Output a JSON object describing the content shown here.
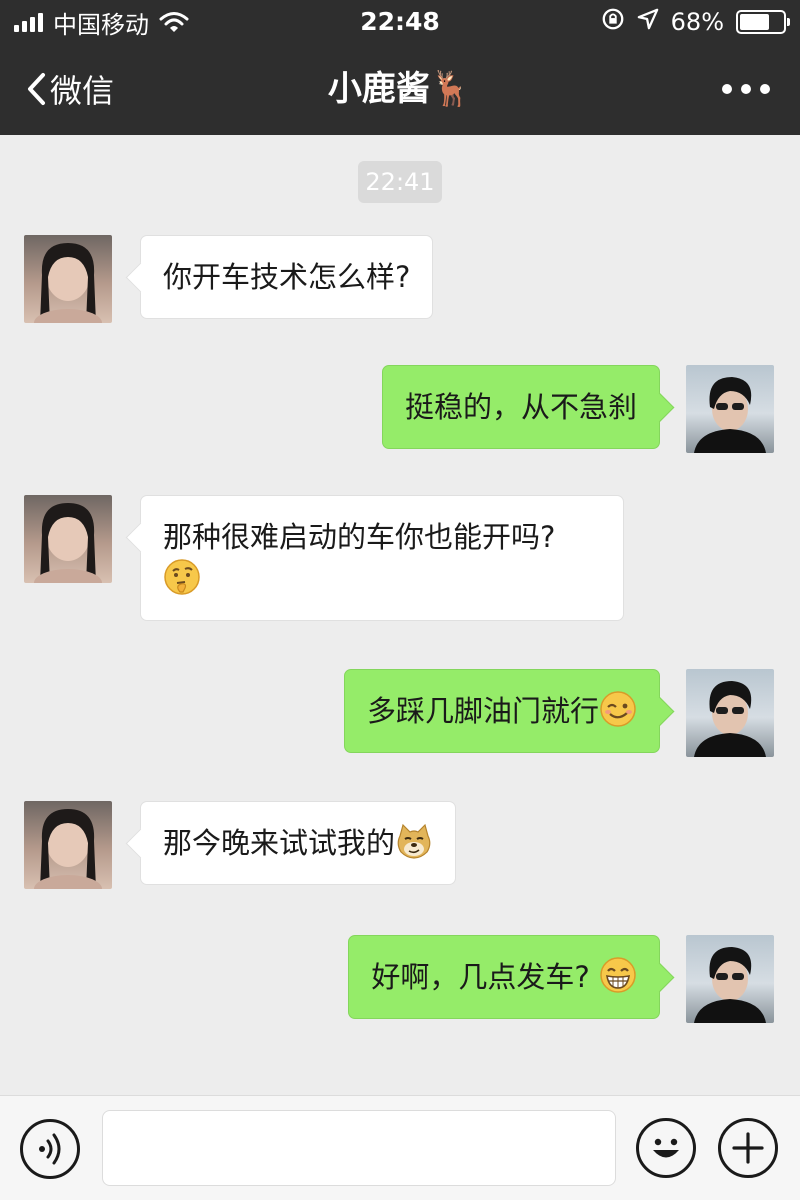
{
  "status_bar": {
    "carrier": "中国移动",
    "time": "22:48",
    "battery_percent": "68%",
    "battery_level": 0.68,
    "icons": [
      "signal-icon",
      "wifi-icon",
      "rotation-lock-icon",
      "location-icon",
      "battery-icon"
    ]
  },
  "nav": {
    "back_label": "微信",
    "title": "小鹿酱🦌",
    "icons": [
      "chevron-left-icon",
      "more-icon"
    ]
  },
  "chat": {
    "timestamp": "22:41",
    "messages": [
      {
        "side": "in",
        "text": "你开车技术怎么样?",
        "emoji": ""
      },
      {
        "side": "out",
        "text": "挺稳的，从不急刹",
        "emoji": ""
      },
      {
        "side": "in",
        "text": "那种很难启动的车你也能开吗?",
        "emoji": "thinking-emoji"
      },
      {
        "side": "out",
        "text": "多踩几脚油门就行",
        "emoji": "wink-emoji"
      },
      {
        "side": "in",
        "text": "那今晚来试试我的",
        "emoji": "doge-emoji"
      },
      {
        "side": "out",
        "text": "好啊，几点发车?",
        "emoji": "grin-emoji"
      }
    ]
  },
  "input_bar": {
    "placeholder": "",
    "icons": [
      "voice-icon",
      "emoji-icon",
      "plus-icon"
    ]
  },
  "colors": {
    "header_bg": "#2e2e2e",
    "chat_bg": "#ededed",
    "bubble_out": "#95ec69",
    "bubble_in": "#ffffff"
  }
}
